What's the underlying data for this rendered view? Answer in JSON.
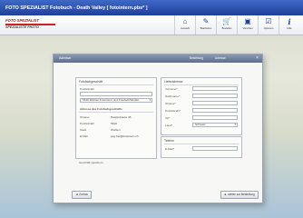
{
  "app": {
    "title": "FOTO SPEZIALIST Fotobuch - Death Valley [ fotointern.pbs* ]",
    "brand_line1": "FOTO SPEZIALIST",
    "brand_line2": "SPEZIALISTE PHOTO",
    "accent_color": "#1f3f9a",
    "brand_color": "#b01a1a"
  },
  "toolbar": [
    {
      "icon": "home-icon",
      "glyph": "⌂",
      "label": "Auswahl"
    },
    {
      "icon": "pencil-icon",
      "glyph": "✎",
      "label": "Bearbeiten"
    },
    {
      "icon": "cart-icon",
      "glyph": "🛒",
      "label": "Bestellen"
    },
    {
      "icon": "preview-icon",
      "glyph": "▣",
      "label": "Vorschau"
    },
    {
      "icon": "options-icon",
      "glyph": "☑",
      "label": "Optionen"
    },
    {
      "icon": "info-icon",
      "glyph": "i",
      "label": "Hilfe"
    }
  ],
  "dialog": {
    "title": "Adresse",
    "tab_1": "Bestellung",
    "tab_2": "Adresse",
    "close": "×",
    "left_panel": {
      "title": "Fotofachgeschäft",
      "postal_label": "Postleitzahl",
      "store_select": "5610 Wohlen Fotointern und Fotofachhändler",
      "address_title": "Adresse des Fotofachgeschäfts",
      "fields": [
        {
          "label": "Strasse",
          "value": "Hauptstrasse 45"
        },
        {
          "label": "Postleitzahl",
          "value": "5610"
        },
        {
          "label": "Stadt",
          "value": "Wohlen"
        },
        {
          "label": "E-Mail",
          "value": "jurg.frei@fotointern.ch"
        }
      ],
      "remember": "Geschäft speichern"
    },
    "right_panel": {
      "title": "Lieferadresse",
      "fields": [
        "Vorname*",
        "Nachname*",
        "Strasse*",
        "Postleitzahl*",
        "Ort*"
      ],
      "country_label": "Land*",
      "country_value": "Schweiz",
      "phone_label": "Telefon",
      "email_label": "E-Mail*"
    },
    "back_button": "◄ Zurück",
    "next_button": "► weiter zur Bestellung"
  }
}
